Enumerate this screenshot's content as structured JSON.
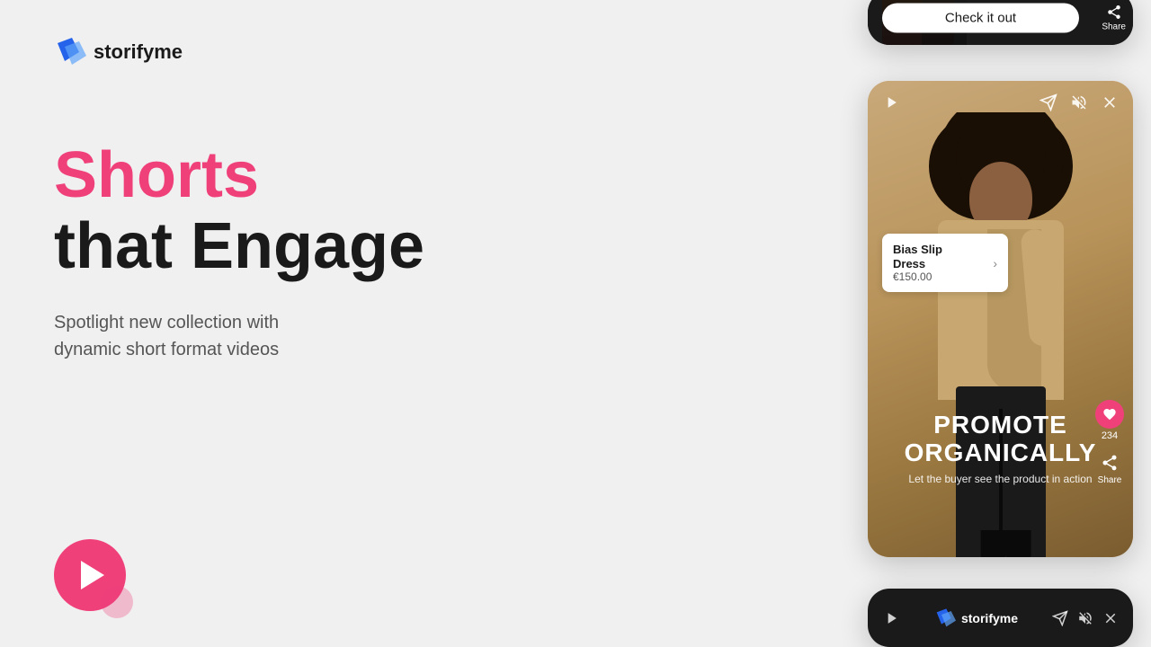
{
  "brand": {
    "name": "storifyme",
    "logo_alt": "storifyme logo"
  },
  "hero": {
    "line1": "Shorts",
    "line2": "that Engage",
    "subtext_line1": "Spotlight new collection with",
    "subtext_line2": "dynamic short format videos"
  },
  "play_button": {
    "label": "Play"
  },
  "top_phone": {
    "cta_label": "Check it out",
    "share_label": "Share"
  },
  "middle_phone": {
    "product_name": "Bias Slip\nDress",
    "product_price": "€150.00",
    "promote_line1": "PROMOTE",
    "promote_line2": "ORGANICALLY",
    "promote_sub": "Let the buyer see the product in action",
    "like_count": "234",
    "share_label": "Share"
  },
  "bottom_phone": {
    "share_label": "Share"
  },
  "colors": {
    "pink": "#f0407a",
    "dark": "#1a1a1a",
    "warm_tan": "#c8a878",
    "text_gray": "#555555",
    "blue": "#2563eb"
  },
  "icons": {
    "play": "▶",
    "share": "➤",
    "mute": "🔇",
    "close": "✕",
    "heart": "♥",
    "chevron_right": "›"
  }
}
